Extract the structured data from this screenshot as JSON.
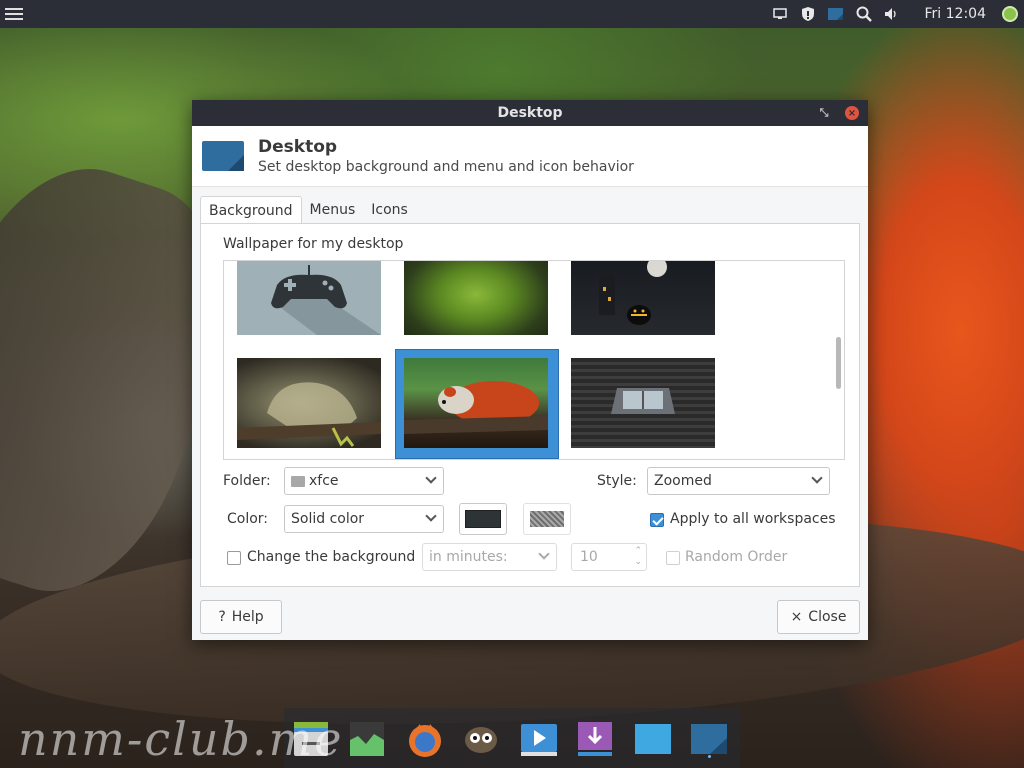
{
  "top_panel": {
    "menu_icon": "hamburger-menu-icon",
    "tray_icons": [
      "display-icon",
      "shield-update-icon",
      "desktop-settings-icon",
      "search-icon",
      "volume-icon"
    ],
    "clock": "Fri 12:04",
    "power_icon": "power-icon"
  },
  "window": {
    "title": "Desktop",
    "header_title": "Desktop",
    "header_subtitle": "Set desktop background and menu and icon behavior"
  },
  "tabs": [
    {
      "label": "Background",
      "active": true
    },
    {
      "label": "Menus",
      "active": false
    },
    {
      "label": "Icons",
      "active": false
    }
  ],
  "background": {
    "section_label": "Wallpaper for my desktop",
    "wallpapers": [
      "gamepad",
      "moss",
      "halloween-pumpkin",
      "iguana",
      "red-panda",
      "window-roof"
    ],
    "selected_wallpaper": "red-panda",
    "folder_label": "Folder:",
    "folder_value": "xfce",
    "style_label": "Style:",
    "style_value": "Zoomed",
    "color_label": "Color:",
    "color_value": "Solid color",
    "color1": "#2e3436",
    "apply_all_label": "Apply to all workspaces",
    "apply_all_checked": true,
    "change_bg_label": "Change the background",
    "change_bg_checked": false,
    "interval_value": "in minutes:",
    "interval_number": "10",
    "random_order_label": "Random Order"
  },
  "buttons": {
    "help_label": "Help",
    "close_label": "Close"
  },
  "dock": [
    "file-manager-icon",
    "system-monitor-icon",
    "firefox-icon",
    "gimp-icon",
    "media-player-icon",
    "installer-icon",
    "folder-icon",
    "desktop-settings-icon"
  ],
  "watermark": "nnm-club.me",
  "colors": {
    "accent": "#3d8fd6",
    "panel": "#2b2e37",
    "close": "#e0533f"
  }
}
